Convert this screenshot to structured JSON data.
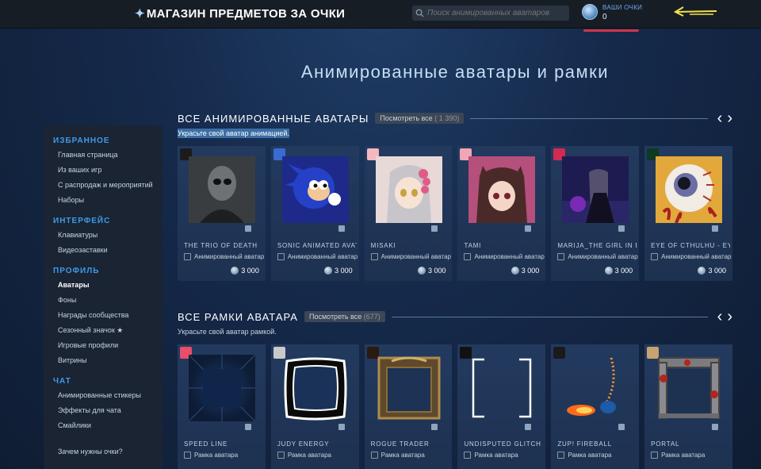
{
  "header": {
    "title": "МАГАЗИН ПРЕДМЕТОВ ЗА ОЧКИ",
    "search_placeholder": "Поиск анимированных аватаров",
    "points_label": "ВАШИ ОЧКИ",
    "points_value": "0"
  },
  "page_title": "Анимированные аватары и рамки",
  "sidebar": {
    "sections": [
      {
        "title": "ИЗБРАННОЕ",
        "items": [
          "Главная страница",
          "Из ваших игр",
          "С распродаж и мероприятий",
          "Наборы"
        ]
      },
      {
        "title": "ИНТЕРФЕЙС",
        "items": [
          "Клавиатуры",
          "Видеозаставки"
        ]
      },
      {
        "title": "ПРОФИЛЬ",
        "items": [
          "Аватары",
          "Фоны",
          "Награды сообщества",
          "Сезонный значок ★",
          "Игровые профили",
          "Витрины"
        ]
      },
      {
        "title": "ЧАТ",
        "items": [
          "Анимированные стикеры",
          "Эффекты для чата",
          "Смайлики"
        ]
      }
    ],
    "active_item": "Аватары",
    "footer": "Зачем нужны очки?"
  },
  "avatars": {
    "title": "ВСЕ АНИМИРОВАННЫЕ АВАТАРЫ",
    "view_all": "Посмотреть все",
    "count": "( 1 390)",
    "subtitle": "Украсьте свой аватар анимацией.",
    "items": [
      {
        "name": "THE TRIO OF DEATH",
        "kind": "Анимированный аватар",
        "price": "3 000"
      },
      {
        "name": "SONIC ANIMATED AVATAR",
        "kind": "Анимированный аватар",
        "price": "3 000"
      },
      {
        "name": "MISAKI",
        "kind": "Анимированный аватар",
        "price": "3 000"
      },
      {
        "name": "TAMI",
        "kind": "Анимированный аватар",
        "price": "3 000"
      },
      {
        "name": "MARIJA_THE GIRL IN BLACK",
        "kind": "Анимированный аватар",
        "price": "3 000"
      },
      {
        "name": "EYE OF CTHULHU - EYE",
        "kind": "Анимированный аватар",
        "price": "3 000"
      }
    ]
  },
  "frames": {
    "title": "ВСЕ РАМКИ АВАТАРА",
    "view_all": "Посмотреть все",
    "count": "(677)",
    "subtitle": "Украсьте свой аватар рамкой.",
    "items": [
      {
        "name": "SPEED LINE",
        "kind": "Рамка аватара"
      },
      {
        "name": "JUDY ENERGY",
        "kind": "Рамка аватара"
      },
      {
        "name": "ROGUE TRADER",
        "kind": "Рамка аватара"
      },
      {
        "name": "UNDISPUTED GLITCH",
        "kind": "Рамка аватара"
      },
      {
        "name": "ZUP! FIREBALL",
        "kind": "Рамка аватара"
      },
      {
        "name": "PORTAL",
        "kind": "Рамка аватара"
      }
    ]
  },
  "icons": {
    "search": "search-icon",
    "points": "steam-points-icon",
    "prev": "chevron-left-icon",
    "next": "chevron-right-icon"
  },
  "colors": {
    "accent": "#3f9bea",
    "topbar": "#171d25",
    "card": "#233a5f",
    "highlight": "#d2334a"
  }
}
